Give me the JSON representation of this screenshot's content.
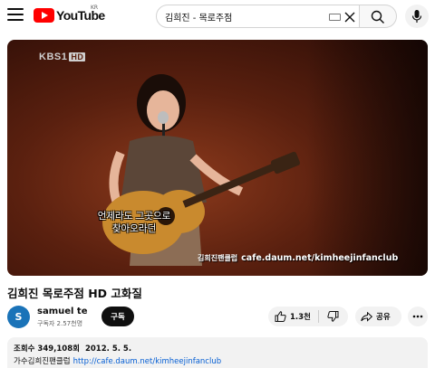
{
  "header": {
    "logo_text": "YouTube",
    "region": "KR",
    "search_value": "김희진 - 목로주점"
  },
  "video": {
    "watermark": "KBS1",
    "watermark_hd": "HD",
    "subtitle_line1": "언제라도 그곳으로",
    "subtitle_line2": "찾아오라던",
    "fanclub_tag": "김희진팬클럽",
    "fanclub_url": "cafe.daum.net/kimheejinfanclub"
  },
  "title": "김희진 목로주점 HD 고화질",
  "channel": {
    "avatar_letter": "S",
    "name": "samuel te",
    "subscribers": "구독자 2.57천명",
    "subscribe_label": "구독"
  },
  "actions": {
    "like_count": "1.3천",
    "share_label": "공유"
  },
  "description": {
    "views": "조회수 349,108회",
    "date": "2012. 5. 5.",
    "text": "가수김희진팬클럽",
    "link": "http://cafe.daum.net/kimheejinfanclub"
  },
  "icons": [
    "menu-icon",
    "youtube-logo-icon",
    "keyboard-icon",
    "clear-icon",
    "search-icon",
    "mic-icon",
    "like-icon",
    "dislike-icon",
    "share-icon",
    "more-icon"
  ],
  "colors": {
    "brand": "#ff0000",
    "link": "#065fd4",
    "subscribe_bg": "#0f0f0f"
  }
}
